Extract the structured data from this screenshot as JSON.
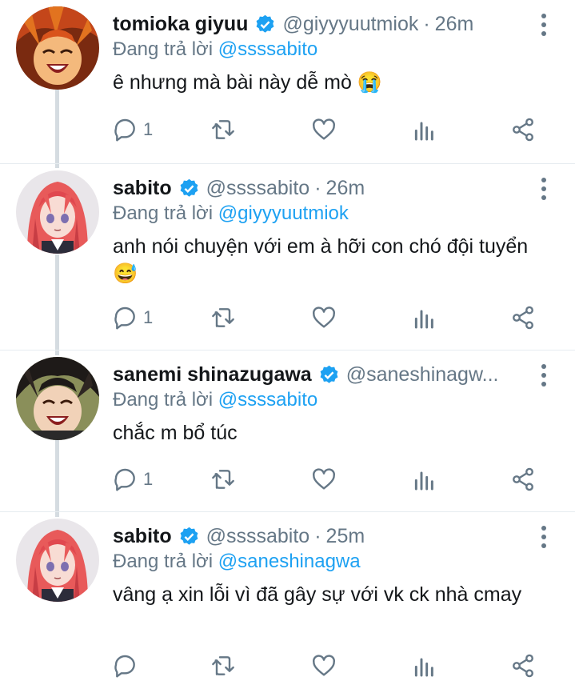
{
  "tweets": [
    {
      "name": "tomioka giyuu",
      "handle": "@giyyyuutmiok",
      "time": "26m",
      "reply_prefix": "Đang trả lời",
      "reply_to": "@ssssabito",
      "text": "ê nhưng mà bài này dễ mò 😭",
      "reply_count": "1",
      "avatar_icon": "orange-haired-laughing-avatar"
    },
    {
      "name": "sabito",
      "handle": "@ssssabito",
      "time": "26m",
      "reply_prefix": "Đang trả lời",
      "reply_to": "@giyyyuutmiok",
      "text": "anh nói chuyện với em à hỡi con chó đội tuyển 😅",
      "reply_count": "1",
      "avatar_icon": "pink-haired-boy-avatar"
    },
    {
      "name": "sanemi shinazugawa",
      "handle": "@saneshinagw...",
      "time": "",
      "reply_prefix": "Đang trả lời",
      "reply_to": "@ssssabito",
      "text": "chắc m bổ túc",
      "reply_count": "1",
      "avatar_icon": "dark-haired-laughing-avatar"
    },
    {
      "name": "sabito",
      "handle": "@ssssabito",
      "time": "25m",
      "reply_prefix": "Đang trả lời",
      "reply_to": "@saneshinagwa",
      "text": "vâng ạ xin lỗi vì đã gây sự với vk ck nhà cmay",
      "reply_count": "",
      "avatar_icon": "pink-haired-boy-avatar"
    }
  ],
  "colors": {
    "accent": "#1da1f2",
    "secondary_text": "#657786",
    "primary_text": "#14171a",
    "thread_line": "#d5dce1"
  }
}
